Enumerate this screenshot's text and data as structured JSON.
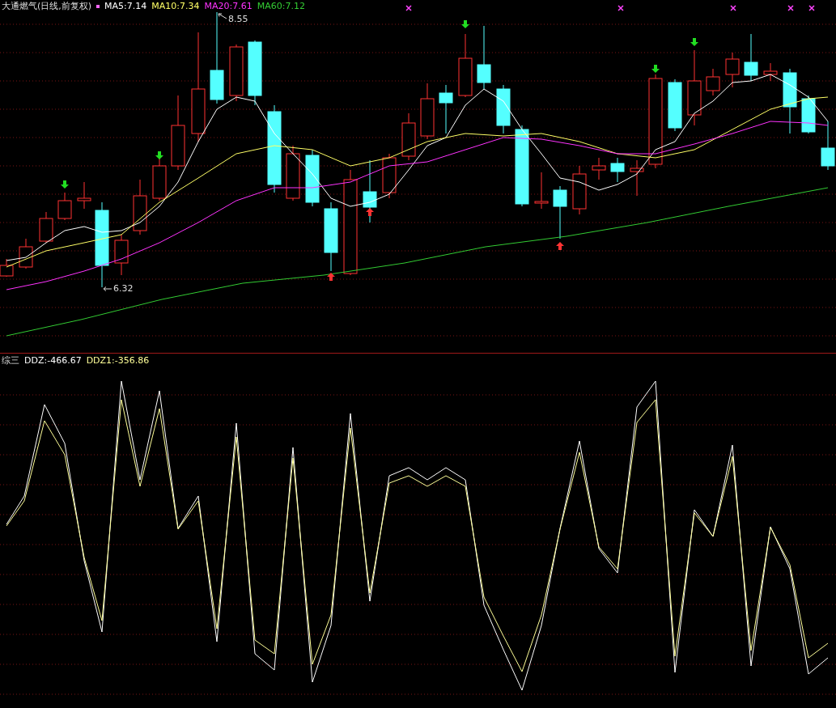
{
  "price_panel": {
    "title": "大通燃气(日线,前复权)",
    "indicators": [
      {
        "label": "MA5:7.14",
        "color": "#ffffff"
      },
      {
        "label": "MA10:7.34",
        "color": "#ffff66"
      },
      {
        "label": "MA20:7.61",
        "color": "#ff33ff"
      },
      {
        "label": "MA60:7.12",
        "color": "#33cc33"
      }
    ],
    "high_label": "8.55",
    "low_label": "6.32"
  },
  "indicator_panel": {
    "name": "综三",
    "values": [
      {
        "label": "DDZ:-466.67",
        "color": "#ffffff"
      },
      {
        "label": "DDZ1:-356.86",
        "color": "#ffff99"
      }
    ]
  }
}
